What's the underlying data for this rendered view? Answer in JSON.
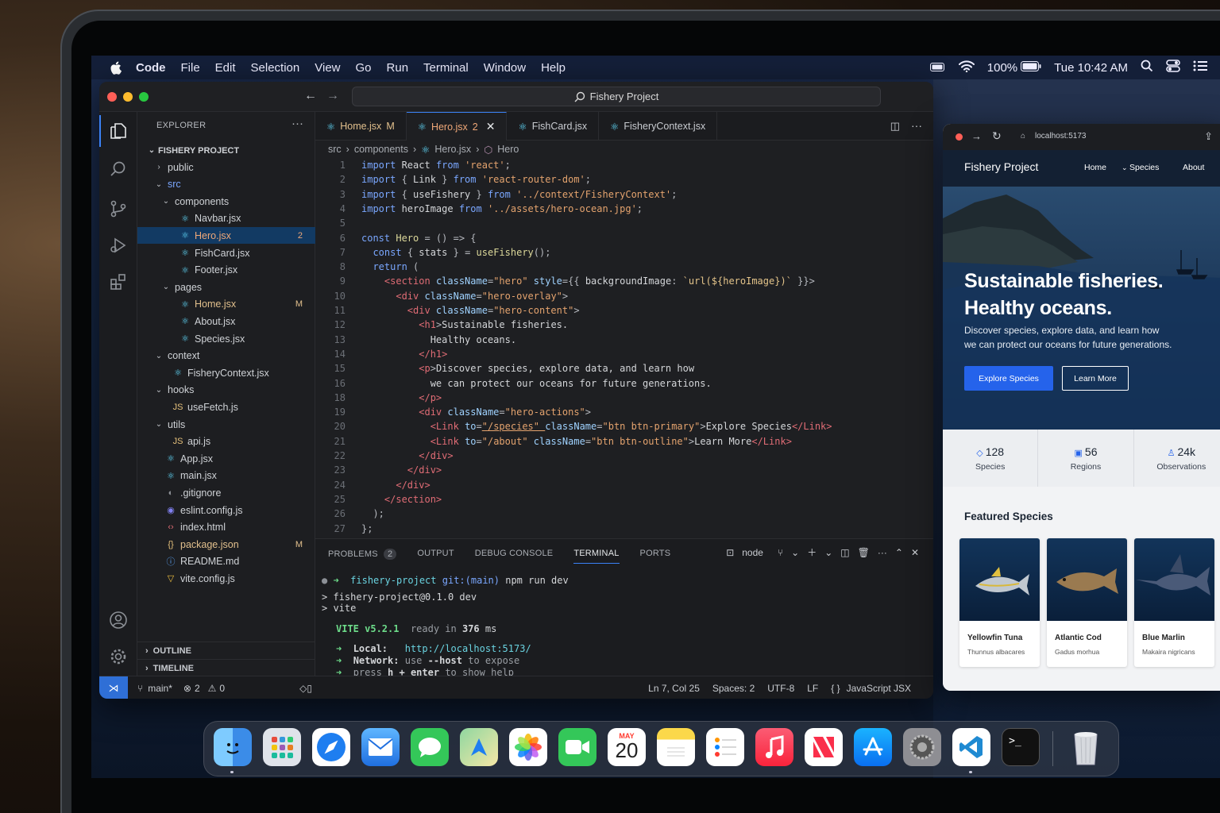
{
  "menubar": {
    "items": [
      "Code",
      "File",
      "Edit",
      "Selection",
      "View",
      "Go",
      "Run",
      "Terminal",
      "Window",
      "Help"
    ],
    "battery": "100%",
    "datetime": "Tue 10:42 AM"
  },
  "vscode": {
    "command_center": "Fishery Project",
    "explorer_title": "EXPLORER",
    "project": "FISHERY PROJECT",
    "tree": [
      {
        "label": "public",
        "depth": 1,
        "kind": "folder-closed"
      },
      {
        "label": "src",
        "depth": 1,
        "kind": "folder-open",
        "accent": true
      },
      {
        "label": "components",
        "depth": 2,
        "kind": "folder-open"
      },
      {
        "label": "Navbar.jsx",
        "depth": 3,
        "kind": "react"
      },
      {
        "label": "Hero.jsx",
        "depth": 3,
        "kind": "react",
        "badge": "2",
        "selected": true,
        "accent": true
      },
      {
        "label": "FishCard.jsx",
        "depth": 3,
        "kind": "react"
      },
      {
        "label": "Footer.jsx",
        "depth": 3,
        "kind": "react"
      },
      {
        "label": "pages",
        "depth": 2,
        "kind": "folder-open"
      },
      {
        "label": "Home.jsx",
        "depth": 3,
        "kind": "react",
        "badge": "M",
        "accent": true
      },
      {
        "label": "About.jsx",
        "depth": 3,
        "kind": "react"
      },
      {
        "label": "Species.jsx",
        "depth": 3,
        "kind": "react"
      },
      {
        "label": "context",
        "depth": 1,
        "kind": "folder-open"
      },
      {
        "label": "FisheryContext.jsx",
        "depth": 2,
        "kind": "react"
      },
      {
        "label": "hooks",
        "depth": 1,
        "kind": "folder-open"
      },
      {
        "label": "useFetch.js",
        "depth": 2,
        "kind": "js"
      },
      {
        "label": "utils",
        "depth": 1,
        "kind": "folder-open"
      },
      {
        "label": "api.js",
        "depth": 2,
        "kind": "js"
      },
      {
        "label": "App.jsx",
        "depth": 1,
        "kind": "react"
      },
      {
        "label": "main.jsx",
        "depth": 1,
        "kind": "react"
      },
      {
        "label": ".gitignore",
        "depth": 1,
        "kind": "git"
      },
      {
        "label": "eslint.config.js",
        "depth": 1,
        "kind": "eslint"
      },
      {
        "label": "index.html",
        "depth": 1,
        "kind": "html"
      },
      {
        "label": "package.json",
        "depth": 1,
        "kind": "json",
        "badge": "M",
        "accent": true
      },
      {
        "label": "README.md",
        "depth": 1,
        "kind": "info"
      },
      {
        "label": "vite.config.js",
        "depth": 1,
        "kind": "vite"
      }
    ],
    "outline": "OUTLINE",
    "timeline": "TIMELINE",
    "tabs": [
      {
        "label": "Home.jsx",
        "suffix": "M",
        "active": false
      },
      {
        "label": "Hero.jsx",
        "suffix": "2",
        "active": true
      },
      {
        "label": "FishCard.jsx",
        "suffix": "",
        "active": false
      },
      {
        "label": "FisheryContext.jsx",
        "suffix": "",
        "active": false
      }
    ],
    "breadcrumb": [
      "src",
      "components",
      "Hero.jsx",
      "Hero"
    ],
    "code": [
      {
        "n": "1",
        "t": [
          [
            "kw",
            "import "
          ],
          [
            "txt",
            "React "
          ],
          [
            "kw",
            "from "
          ],
          [
            "str",
            "'react'"
          ],
          [
            "pun",
            ";"
          ]
        ]
      },
      {
        "n": "2",
        "t": [
          [
            "kw",
            "import "
          ],
          [
            "pun",
            "{ "
          ],
          [
            "txt",
            "Link "
          ],
          [
            "pun",
            "} "
          ],
          [
            "kw",
            "from "
          ],
          [
            "str",
            "'react-router-dom'"
          ],
          [
            "pun",
            ";"
          ]
        ]
      },
      {
        "n": "3",
        "t": [
          [
            "kw",
            "import "
          ],
          [
            "pun",
            "{ "
          ],
          [
            "txt",
            "useFishery "
          ],
          [
            "pun",
            "} "
          ],
          [
            "kw",
            "from "
          ],
          [
            "str",
            "'../context/FisheryContext'"
          ],
          [
            "pun",
            ";"
          ]
        ]
      },
      {
        "n": "4",
        "t": [
          [
            "kw",
            "import "
          ],
          [
            "txt",
            "heroImage "
          ],
          [
            "kw",
            "from "
          ],
          [
            "str",
            "'../assets/hero-ocean.jpg'"
          ],
          [
            "pun",
            ";"
          ]
        ]
      },
      {
        "n": "5",
        "t": []
      },
      {
        "n": "6",
        "t": [
          [
            "kw",
            "const "
          ],
          [
            "fn",
            "Hero "
          ],
          [
            "pun",
            "= () => {"
          ]
        ]
      },
      {
        "n": "7",
        "t": [
          [
            "txt",
            "  "
          ],
          [
            "kw",
            "const "
          ],
          [
            "pun",
            "{ "
          ],
          [
            "txt",
            "stats "
          ],
          [
            "pun",
            "} = "
          ],
          [
            "fn",
            "useFishery"
          ],
          [
            "pun",
            "();"
          ]
        ]
      },
      {
        "n": "8",
        "t": [
          [
            "txt",
            "  "
          ],
          [
            "kw",
            "return "
          ],
          [
            "pun",
            "("
          ]
        ]
      },
      {
        "n": "9",
        "t": [
          [
            "txt",
            "    "
          ],
          [
            "tag",
            "<section "
          ],
          [
            "attr",
            "className"
          ],
          [
            "pun",
            "="
          ],
          [
            "str",
            "\"hero\" "
          ],
          [
            "attr",
            "style"
          ],
          [
            "pun",
            "={{ "
          ],
          [
            "txt",
            "backgroundImage"
          ],
          [
            "pun",
            ": "
          ],
          [
            "tmpl",
            "`url(${heroImage})`"
          ],
          [
            "pun",
            " }}>"
          ]
        ]
      },
      {
        "n": "10",
        "t": [
          [
            "txt",
            "      "
          ],
          [
            "tag",
            "<div "
          ],
          [
            "attr",
            "className"
          ],
          [
            "pun",
            "="
          ],
          [
            "str",
            "\"hero-overlay\""
          ],
          [
            "pun",
            ">"
          ]
        ]
      },
      {
        "n": "11",
        "t": [
          [
            "txt",
            "        "
          ],
          [
            "tag",
            "<div "
          ],
          [
            "attr",
            "className"
          ],
          [
            "pun",
            "="
          ],
          [
            "str",
            "\"hero-content\""
          ],
          [
            "pun",
            ">"
          ]
        ]
      },
      {
        "n": "12",
        "t": [
          [
            "txt",
            "          "
          ],
          [
            "tag",
            "<h1"
          ],
          [
            "pun",
            ">"
          ],
          [
            "txt",
            "Sustainable fisheries."
          ]
        ]
      },
      {
        "n": "13",
        "t": [
          [
            "txt",
            "            Healthy oceans."
          ]
        ]
      },
      {
        "n": "14",
        "t": [
          [
            "txt",
            "          "
          ],
          [
            "tag",
            "</h1>"
          ]
        ]
      },
      {
        "n": "15",
        "t": [
          [
            "txt",
            "          "
          ],
          [
            "tag",
            "<p"
          ],
          [
            "pun",
            ">"
          ],
          [
            "txt",
            "Discover species, explore data, and learn how"
          ]
        ]
      },
      {
        "n": "16",
        "t": [
          [
            "txt",
            "            we can protect our oceans for future generations."
          ]
        ]
      },
      {
        "n": "18",
        "t": [
          [
            "txt",
            "          "
          ],
          [
            "tag",
            "</p>"
          ]
        ]
      },
      {
        "n": "19",
        "t": [
          [
            "txt",
            "          "
          ],
          [
            "tag",
            "<div "
          ],
          [
            "attr",
            "className"
          ],
          [
            "pun",
            "="
          ],
          [
            "str",
            "\"hero-actions\""
          ],
          [
            "pun",
            ">"
          ]
        ]
      },
      {
        "n": "20",
        "t": [
          [
            "txt",
            "            "
          ],
          [
            "tag",
            "<Link "
          ],
          [
            "attr",
            "to"
          ],
          [
            "pun",
            "="
          ],
          [
            "str",
            "\"/species\" "
          ],
          [
            "attr",
            "className"
          ],
          [
            "pun",
            "="
          ],
          [
            "str",
            "\"btn btn-primary\""
          ],
          [
            "pun",
            ">"
          ],
          [
            "txt",
            "Explore Species"
          ],
          [
            "tag",
            "</Link>"
          ]
        ]
      },
      {
        "n": "21",
        "t": [
          [
            "txt",
            "            "
          ],
          [
            "tag",
            "<Link "
          ],
          [
            "attr",
            "to"
          ],
          [
            "pun",
            "="
          ],
          [
            "str",
            "\"/about\" "
          ],
          [
            "attr",
            "className"
          ],
          [
            "pun",
            "="
          ],
          [
            "str",
            "\"btn btn-outline\""
          ],
          [
            "pun",
            ">"
          ],
          [
            "txt",
            "Learn More"
          ],
          [
            "tag",
            "</Link>"
          ]
        ]
      },
      {
        "n": "22",
        "t": [
          [
            "txt",
            "          "
          ],
          [
            "tag",
            "</div>"
          ]
        ]
      },
      {
        "n": "23",
        "t": [
          [
            "txt",
            "        "
          ],
          [
            "tag",
            "</div>"
          ]
        ]
      },
      {
        "n": "24",
        "t": [
          [
            "txt",
            "      "
          ],
          [
            "tag",
            "</div>"
          ]
        ]
      },
      {
        "n": "25",
        "t": [
          [
            "txt",
            "    "
          ],
          [
            "tag",
            "</section>"
          ]
        ]
      },
      {
        "n": "26",
        "t": [
          [
            "txt",
            "  "
          ],
          [
            "pun",
            ");"
          ]
        ]
      },
      {
        "n": "27",
        "t": [
          [
            "pun",
            "};"
          ]
        ]
      }
    ],
    "panel_tabs": [
      "PROBLEMS",
      "OUTPUT",
      "DEBUG CONSOLE",
      "TERMINAL",
      "PORTS"
    ],
    "problems_count": "2",
    "terminal_shell": "node",
    "terminal": {
      "prompt_dir": "fishery-project",
      "prompt_git": "git:(main)",
      "prompt_cmd": "npm run dev",
      "out1": "> fishery-project@0.1.0 dev",
      "out2": "> vite",
      "vite_name": "VITE v5.2.1",
      "vite_ready": "ready in",
      "vite_ms": "376",
      "vite_unit": "ms",
      "local_label": "Local:",
      "local_url": "http://localhost:5173/",
      "network_label": "Network:",
      "network_pre": "use",
      "network_flag": "--host",
      "network_post": "to expose",
      "help_pre": "press",
      "help_key": "h + enter",
      "help_post": "to show help"
    },
    "status": {
      "branch": "main*",
      "errors": "2",
      "warnings": "0",
      "position": "Ln 7, Col 25",
      "spaces": "Spaces: 2",
      "encoding": "UTF-8",
      "eol": "LF",
      "language": "JavaScript JSX"
    }
  },
  "browser": {
    "url": "localhost:5173",
    "brand": "Fishery Project",
    "nav": [
      "Home",
      "Species",
      "About"
    ],
    "hero_title_1": "Sustainable fisheries.",
    "hero_title_2": "Healthy oceans.",
    "hero_sub_1": "Discover species, explore data, and learn how",
    "hero_sub_2": "we can protect our oceans for future generations.",
    "btn_primary": "Explore Species",
    "btn_outline": "Learn More",
    "stats": [
      {
        "value": "128",
        "label": "Species",
        "icon": "fish-icon"
      },
      {
        "value": "56",
        "label": "Regions",
        "icon": "map-pin-icon"
      },
      {
        "value": "24k",
        "label": "Observations",
        "icon": "user-icon"
      }
    ],
    "featured_title": "Featured Species",
    "cards": [
      {
        "name": "Yellowfin Tuna",
        "sci": "Thunnus albacares"
      },
      {
        "name": "Atlantic Cod",
        "sci": "Gadus morhua"
      },
      {
        "name": "Blue Marlin",
        "sci": "Makaira nigricans"
      }
    ]
  },
  "dock": {
    "calendar_month": "MAY",
    "calendar_day": "20",
    "apps": [
      "finder",
      "launchpad",
      "safari",
      "mail",
      "messages",
      "maps",
      "photos",
      "facetime",
      "calendar",
      "notes",
      "reminders",
      "music",
      "news",
      "app-store",
      "system-settings",
      "vscode",
      "terminal",
      "trash"
    ]
  },
  "colors": {
    "accent": "#3b82f6",
    "modified": "#e2c08d",
    "editor_bg": "#1e1f22",
    "primary_button": "#2563eb"
  }
}
